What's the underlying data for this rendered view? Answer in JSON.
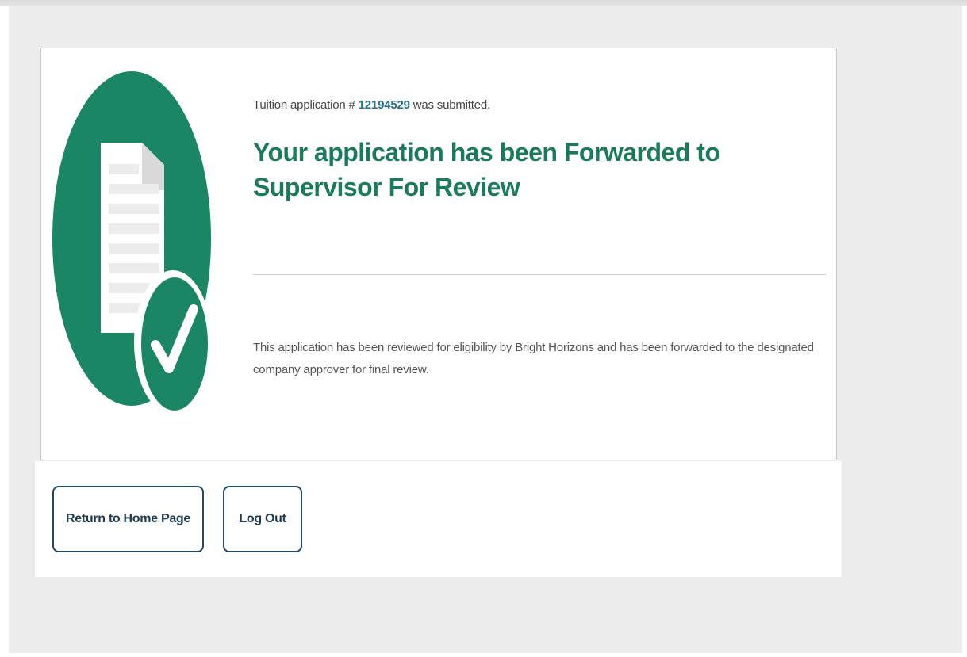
{
  "confirmation": {
    "prefix": "Tuition application # ",
    "application_number": "12194529",
    "suffix": " was submitted.",
    "headline": "Your application has been Forwarded to Supervisor For Review",
    "description": "This application has been reviewed for eligibility by Bright Horizons and has been forwarded to the designated company approver for final review."
  },
  "actions": {
    "home_label": "Return to Home Page",
    "logout_label": "Log Out"
  },
  "illustration": {
    "icons": [
      "document-icon",
      "checkmark-icon"
    ],
    "brand_color": "#1b8663"
  },
  "colors": {
    "brand_green": "#1b7a58",
    "link_blue": "#2c6e85",
    "button_border": "#234b66",
    "page_background": "#ececec"
  }
}
